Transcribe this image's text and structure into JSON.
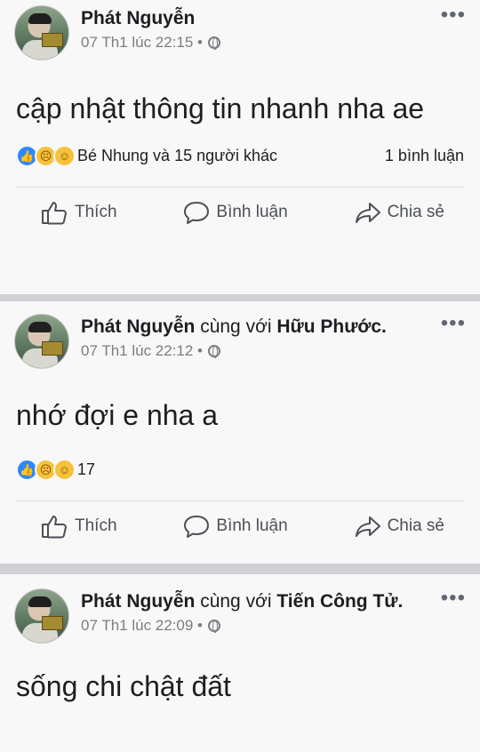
{
  "actions": {
    "like": "Thích",
    "comment": "Bình luận",
    "share": "Chia sẻ"
  },
  "posts": [
    {
      "author": "Phát Nguyễn",
      "with_word": "",
      "tagged": "",
      "time": "07 Th1 lúc 22:15 •",
      "text": "cập nhật thông tin nhanh nha ae",
      "reactions_text": "Bé Nhung và 15 người khác",
      "comments_text": "1 bình luận"
    },
    {
      "author": "Phát Nguyễn",
      "with_word": "cùng với",
      "tagged": "Hữu Phước.",
      "time": "07 Th1 lúc 22:12 •",
      "text": "nhớ đợi e nha a",
      "reactions_text": "17",
      "comments_text": ""
    },
    {
      "author": "Phát Nguyễn",
      "with_word": "cùng với",
      "tagged": "Tiến Công Tử.",
      "time": "07 Th1 lúc 22:09 •",
      "text": "sống chi chật đất"
    }
  ]
}
